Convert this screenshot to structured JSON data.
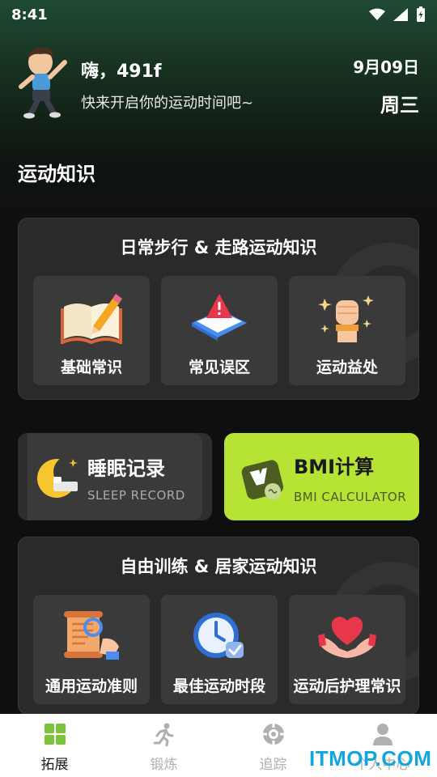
{
  "status_bar": {
    "time": "8:41"
  },
  "header": {
    "greeting": "嗨，491f",
    "subtitle": "快来开启你的运动时间吧~",
    "date": "9月09日",
    "weekday": "周三"
  },
  "section_title": "运动知识",
  "walking_card": {
    "title": "日常步行 & 走路运动知识",
    "tiles": [
      {
        "label": "基础常识",
        "icon": "book-pencil-icon"
      },
      {
        "label": "常见误区",
        "icon": "warning-icon"
      },
      {
        "label": "运动益处",
        "icon": "fist-icon"
      }
    ]
  },
  "sleep_card": {
    "title": "睡眠记录",
    "subtitle": "SLEEP RECORD"
  },
  "bmi_card": {
    "title": "BMI计算",
    "subtitle": "BMI CALCULATOR"
  },
  "home_card": {
    "title": "自由训练 & 居家运动知识",
    "tiles": [
      {
        "label": "通用运动准则",
        "icon": "scroll-icon"
      },
      {
        "label": "最佳运动时段",
        "icon": "clock-icon"
      },
      {
        "label": "运动后护理常识",
        "icon": "heart-hands-icon"
      }
    ]
  },
  "tabbar": {
    "tabs": [
      {
        "label": "拓展",
        "icon": "grid-icon",
        "active": true
      },
      {
        "label": "锻炼",
        "icon": "running-icon",
        "active": false
      },
      {
        "label": "追踪",
        "icon": "target-icon",
        "active": false
      },
      {
        "label": "个人中心",
        "icon": "person-icon",
        "active": false
      }
    ]
  },
  "watermark": "ITMOP.COM",
  "colors": {
    "accent": "#b7e335",
    "tab_active": "#7bc43a",
    "watermark": "#12a7dc"
  }
}
